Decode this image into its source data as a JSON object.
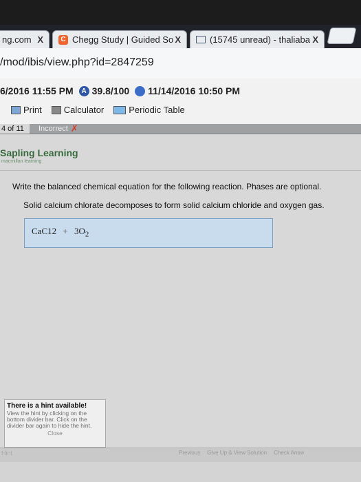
{
  "browser": {
    "tabs": [
      {
        "label": "ng.com",
        "close": "X"
      },
      {
        "label": "Chegg Study | Guided So",
        "icon": "chegg-icon",
        "close": "X"
      },
      {
        "label": "(15745 unread) - thaliaba",
        "icon": "mail-icon",
        "close": "X"
      }
    ],
    "url": "/mod/ibis/view.php?id=2847259"
  },
  "toolbar": {
    "start_date": "6/2016 11:55 PM",
    "score": "39.8/100",
    "due_date": "11/14/2016 10:50 PM",
    "print_label": "Print",
    "calculator_label": "Calculator",
    "periodic_table_label": "Periodic Table"
  },
  "question_bar": {
    "number": "4 of 11",
    "status": "Incorrect"
  },
  "sapling": {
    "title": "Sapling Learning",
    "subtitle": "macmillan learning"
  },
  "question": {
    "prompt": "Write the balanced chemical equation for the following reaction. Phases are optional.",
    "reaction": "Solid calcium chlorate decomposes to form solid calcium chloride and oxygen gas."
  },
  "answer": {
    "term1": "CaC12",
    "operator": "+",
    "term2": "3O",
    "term2_sub": "2"
  },
  "hint": {
    "title": "There is a hint available!",
    "body": "View the hint by clicking on the bottom divider bar. Click on the divider bar again to hide the hint.",
    "close": "Close"
  },
  "bottom": {
    "hint_tab": "Hint",
    "previous": "Previous",
    "give_up": "Give Up & View Solution",
    "check": "Check Answ"
  },
  "colors": {
    "answer_box": "#c9dcee",
    "incorrect": "#d23a2a",
    "sapling_green": "#3a6b3f"
  }
}
